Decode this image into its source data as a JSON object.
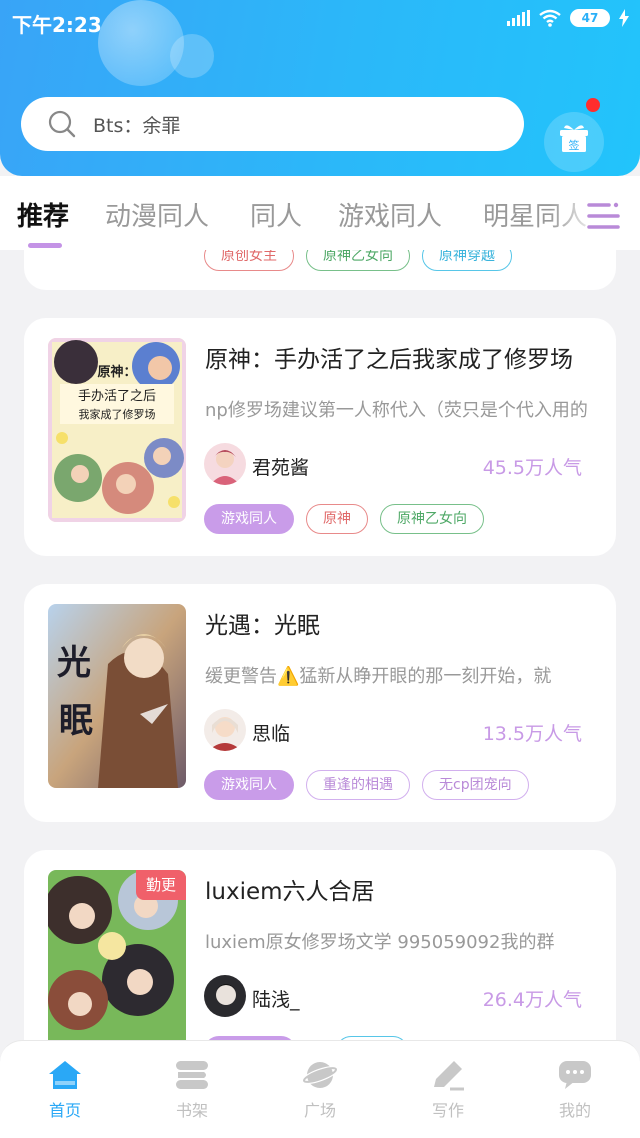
{
  "status_bar": {
    "time": "下午2:23",
    "battery": "47"
  },
  "search": {
    "placeholder": "Bts：余罪"
  },
  "gift": {
    "label": "签"
  },
  "tabs": [
    {
      "label": "推荐",
      "active": true
    },
    {
      "label": "动漫同人"
    },
    {
      "label": "同人"
    },
    {
      "label": "游戏同人"
    },
    {
      "label": "明星同人"
    }
  ],
  "partial_card": {
    "tags": [
      "原创女主",
      "原神乙女向",
      "原神穿越"
    ]
  },
  "cards": [
    {
      "title": "原神：手办活了之后我家成了修罗场",
      "description": "np修罗场建议第一人称代入（荧只是个代入用的",
      "author": "君苑酱",
      "popularity": "45.5万人气",
      "tags": [
        "游戏同人",
        "原神",
        "原神乙女向"
      ],
      "cover_text": [
        "原神：",
        "手办活了之后",
        "我家成了修罗场"
      ]
    },
    {
      "title": "光遇：光眠",
      "description": "缓更警告⚠️猛新从睁开眼的那一刻开始，就",
      "author": "思临",
      "popularity": "13.5万人气",
      "tags": [
        "游戏同人",
        "重逢的相遇",
        "无cp团宠向"
      ],
      "cover_text": [
        "光",
        "眠"
      ]
    },
    {
      "title": "luxiem六人合居",
      "description": "luxiem原女修罗场文学 995059092我的群",
      "author": "陆浅_",
      "popularity": "26.4万人气",
      "badge": "勤更",
      "tags": [
        "",
        ""
      ]
    }
  ],
  "bottom_nav": [
    {
      "label": "首页",
      "icon": "home-icon",
      "active": true
    },
    {
      "label": "书架",
      "icon": "bookshelf-icon"
    },
    {
      "label": "广场",
      "icon": "planet-icon"
    },
    {
      "label": "写作",
      "icon": "pen-icon"
    },
    {
      "label": "我的",
      "icon": "chat-bubble-icon"
    }
  ],
  "colors": {
    "header_start": "#39a4f7",
    "header_end": "#22c4fb",
    "accent_purple": "#c99ce9",
    "nav_active": "#2aa8f6"
  }
}
